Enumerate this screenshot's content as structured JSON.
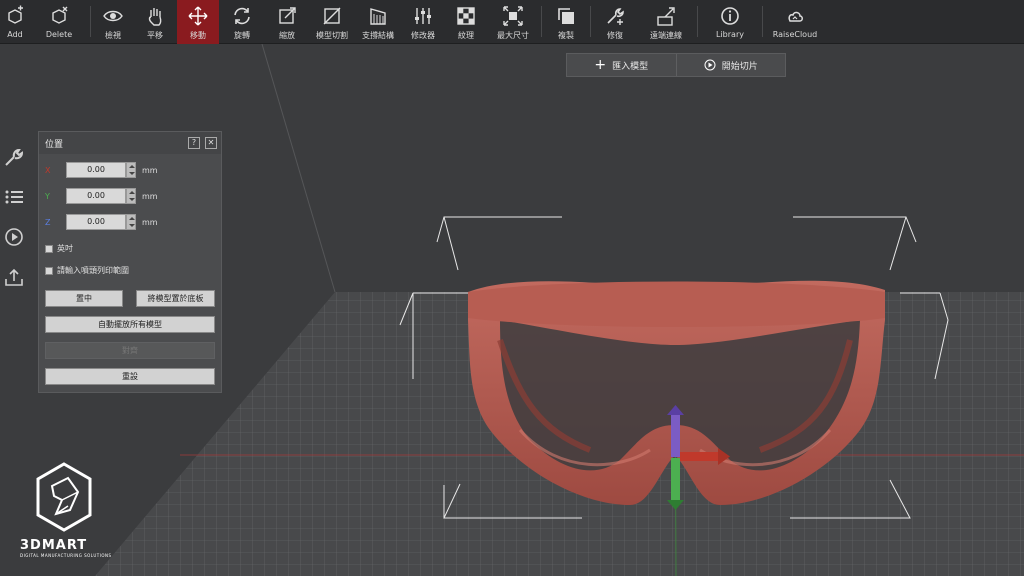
{
  "toolbar": {
    "add": "Add",
    "delete": "Delete",
    "view": "檢視",
    "pan": "平移",
    "move": "移動",
    "rotate": "旋轉",
    "scale": "縮放",
    "cut": "模型切割",
    "support": "支撐結構",
    "modifier": "修改器",
    "texture": "紋理",
    "maxsize": "最大尺寸",
    "copy": "複製",
    "repair": "修復",
    "remote": "遠端連線",
    "library": "Library",
    "raisecloud": "RaiseCloud"
  },
  "slice_bar": {
    "import": "匯入模型",
    "start_slice": "開始切片"
  },
  "panel": {
    "title": "位置",
    "help": "?",
    "close": "✕",
    "x_label": "X",
    "y_label": "Y",
    "z_label": "Z",
    "x_value": "0.00",
    "y_value": "0.00",
    "z_value": "0.00",
    "unit": "mm",
    "inch_label": "英吋",
    "limit_label": "請輸入噴頭列印範圍",
    "center_button": "置中",
    "drop_button": "將模型置於底板",
    "auto_arrange_button": "自動擺放所有模型",
    "align_button": "對齊",
    "reset_button": "重設"
  },
  "colors": {
    "toolbar_bg": "#2b2c2e",
    "active": "#8a1b1f",
    "model": "#b4564c",
    "x_axis": "#c0392b",
    "y_axis": "#4caf50",
    "z_axis": "#7b5cc4"
  },
  "logo": {
    "name": "3DMART",
    "tagline": "DIGITAL MANUFACTURING SOLUTIONS"
  }
}
